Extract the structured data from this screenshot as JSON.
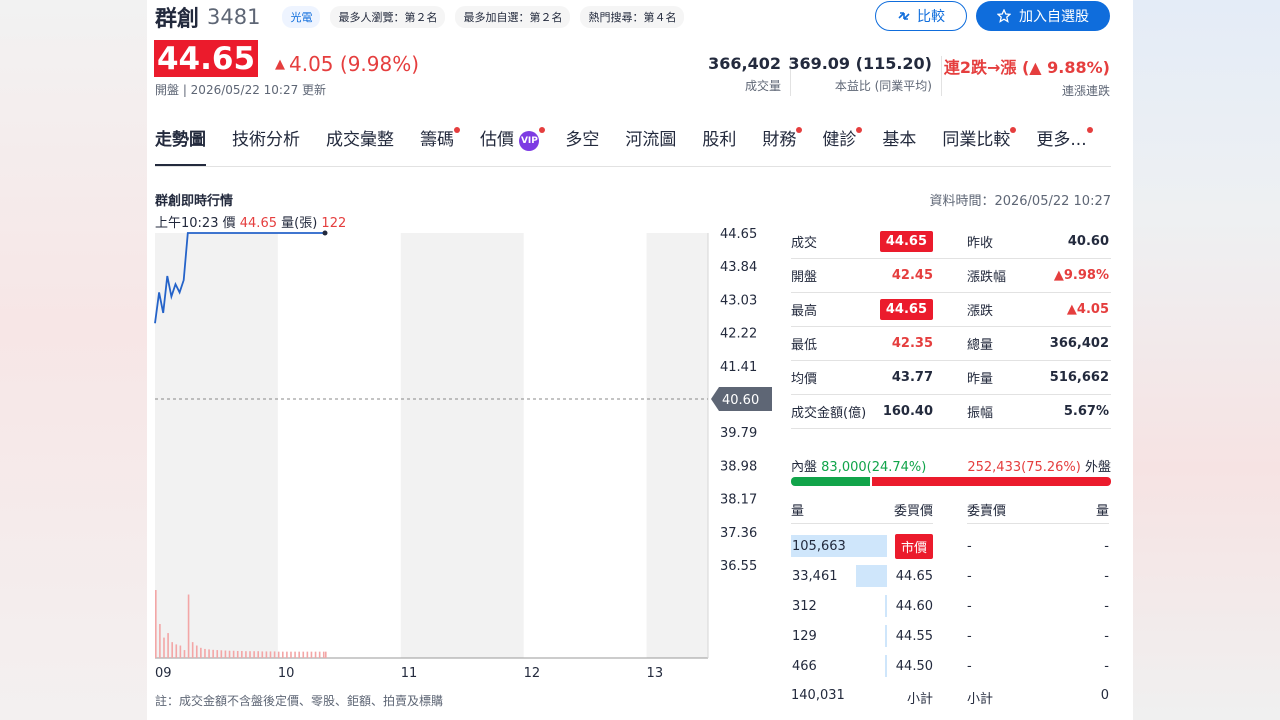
{
  "header": {
    "name": "群創",
    "code": "3481",
    "tags": [
      "光電",
      "最多人瀏覽：第２名",
      "最多加自選：第２名",
      "熱門搜尋：第４名"
    ],
    "compare_label": "比較",
    "add_label": "加入自選股",
    "price": "44.65",
    "change": "4.05 (9.98%)",
    "updated": "開盤 | 2026/05/22 10:27 更新",
    "stats": [
      {
        "value": "366,402",
        "label": "成交量"
      },
      {
        "value": "369.09 (115.20)",
        "label": "本益比 (同業平均)"
      },
      {
        "value": "連2跌→漲 (▲ 9.88%)",
        "label": "連漲連跌"
      }
    ]
  },
  "tabs": [
    {
      "label": "走勢圖",
      "dot": false
    },
    {
      "label": "技術分析",
      "dot": false
    },
    {
      "label": "成交彙整",
      "dot": false
    },
    {
      "label": "籌碼",
      "dot": true
    },
    {
      "label": "估價",
      "dot": true
    },
    {
      "label": "多空",
      "dot": false
    },
    {
      "label": "河流圖",
      "dot": false
    },
    {
      "label": "股利",
      "dot": false
    },
    {
      "label": "財務",
      "dot": true
    },
    {
      "label": "健診",
      "dot": true
    },
    {
      "label": "基本",
      "dot": false
    },
    {
      "label": "同業比較",
      "dot": true
    },
    {
      "label": "更多...",
      "dot": true
    }
  ],
  "vip_label": "VIP",
  "chart_section": {
    "title": "群創即時行情",
    "data_time": "資料時間：2026/05/22 10:27",
    "tooltip": {
      "time": "上午10:23",
      "price_label": "價",
      "price": "44.65",
      "vol_label": "量(張)",
      "vol": "122"
    },
    "note": "註：成交金額不含盤後定價、零股、鉅額、拍賣及標購"
  },
  "chart_data": {
    "type": "line",
    "title": "",
    "y_ticks": [
      "44.65",
      "43.84",
      "43.03",
      "42.22",
      "41.41",
      "40.60",
      "39.79",
      "38.98",
      "38.17",
      "37.36",
      "36.55"
    ],
    "x_ticks": [
      "09",
      "10",
      "11",
      "12",
      "13"
    ],
    "ylim": [
      36.55,
      44.65
    ],
    "reference": 40.6,
    "colors": {
      "line": "#2563c9",
      "volume": "#f3a6a6",
      "reference": "#888888"
    },
    "x": [
      0,
      2,
      4,
      6,
      8,
      10,
      12,
      14,
      16,
      18,
      20,
      22,
      24,
      26,
      28,
      30,
      32,
      34,
      36,
      38,
      40,
      42,
      44,
      46,
      48,
      50,
      52,
      54,
      56,
      58,
      60,
      62,
      64,
      66,
      68,
      70,
      72,
      74,
      76,
      78,
      80,
      82,
      83
    ],
    "price": [
      42.45,
      43.2,
      42.7,
      43.6,
      43.1,
      43.4,
      43.2,
      43.5,
      44.65,
      44.65,
      44.65,
      44.65,
      44.65,
      44.65,
      44.65,
      44.65,
      44.65,
      44.65,
      44.65,
      44.65,
      44.65,
      44.65,
      44.65,
      44.65,
      44.65,
      44.65,
      44.65,
      44.65,
      44.65,
      44.65,
      44.65,
      44.65,
      44.65,
      44.65,
      44.65,
      44.65,
      44.65,
      44.65,
      44.65,
      44.65,
      44.65,
      44.65,
      44.65
    ],
    "volume": [
      30000,
      15000,
      9000,
      11000,
      7000,
      6000,
      5500,
      3500,
      28000,
      7000,
      5500,
      4500,
      4000,
      3800,
      3600,
      3500,
      3400,
      3300,
      3200,
      3200,
      3100,
      3100,
      3000,
      3000,
      3000,
      3000,
      2900,
      2900,
      2900,
      2900,
      2800,
      2800,
      2800,
      2800,
      2800,
      2800,
      2800,
      2800,
      2800,
      2800,
      2800,
      2800,
      2800
    ]
  },
  "quote": {
    "rows": [
      [
        {
          "label": "成交",
          "value": "44.65",
          "style": "box"
        },
        {
          "label": "昨收",
          "value": "40.60",
          "style": ""
        }
      ],
      [
        {
          "label": "開盤",
          "value": "42.45",
          "style": "red"
        },
        {
          "label": "漲跌幅",
          "value": "▲9.98%",
          "style": "red"
        }
      ],
      [
        {
          "label": "最高",
          "value": "44.65",
          "style": "box"
        },
        {
          "label": "漲跌",
          "value": "▲4.05",
          "style": "red"
        }
      ],
      [
        {
          "label": "最低",
          "value": "42.35",
          "style": "red"
        },
        {
          "label": "總量",
          "value": "366,402",
          "style": ""
        }
      ],
      [
        {
          "label": "均價",
          "value": "43.77",
          "style": ""
        },
        {
          "label": "昨量",
          "value": "516,662",
          "style": ""
        }
      ],
      [
        {
          "label": "成交金額(億)",
          "value": "160.40",
          "style": ""
        },
        {
          "label": "振幅",
          "value": "5.67%",
          "style": ""
        }
      ]
    ]
  },
  "inner_outer": {
    "inner_label": "內盤",
    "inner_value": "83,000(24.74%)",
    "outer_value": "252,433(75.26%)",
    "outer_label": "外盤",
    "inner_pct": 24.74
  },
  "order_book": {
    "headers": [
      "量",
      "委買價",
      "委賣價",
      "量"
    ],
    "rows": [
      {
        "bid_vol": "105,663",
        "bid_price": "市價",
        "ask_price": "-",
        "ask_vol": "-",
        "bar": 1.0,
        "box": true
      },
      {
        "bid_vol": "33,461",
        "bid_price": "44.65",
        "ask_price": "-",
        "ask_vol": "-",
        "bar": 0.32,
        "box": false
      },
      {
        "bid_vol": "312",
        "bid_price": "44.60",
        "ask_price": "-",
        "ask_vol": "-",
        "bar": 0.003,
        "box": false
      },
      {
        "bid_vol": "129",
        "bid_price": "44.55",
        "ask_price": "-",
        "ask_vol": "-",
        "bar": 0.001,
        "box": false
      },
      {
        "bid_vol": "466",
        "bid_price": "44.50",
        "ask_price": "-",
        "ask_vol": "-",
        "bar": 0.004,
        "box": false
      }
    ],
    "subtotal": {
      "bid_total": "140,031",
      "bid_label": "小計",
      "ask_label": "小計",
      "ask_total": "0"
    }
  }
}
